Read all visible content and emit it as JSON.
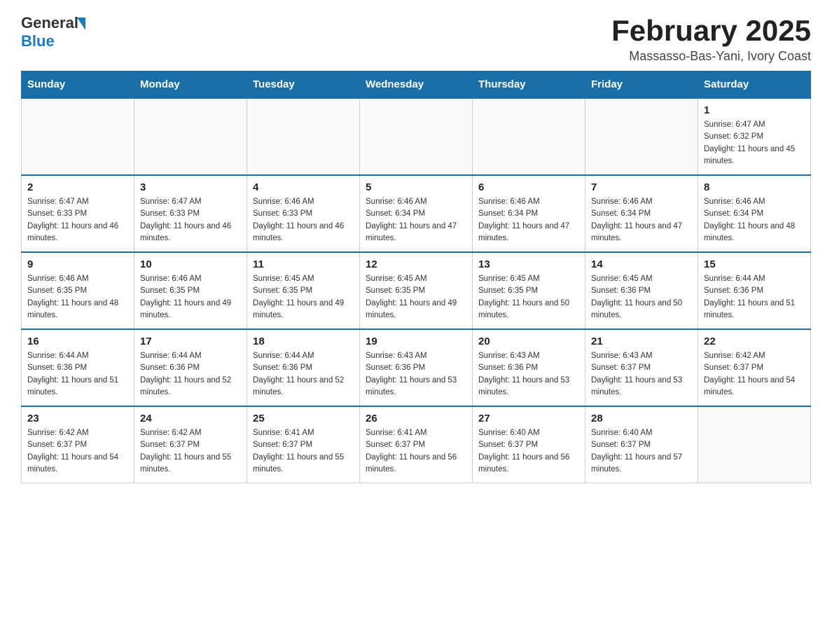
{
  "logo": {
    "general": "General",
    "blue": "Blue"
  },
  "title": "February 2025",
  "subtitle": "Massasso-Bas-Yani, Ivory Coast",
  "days_of_week": [
    "Sunday",
    "Monday",
    "Tuesday",
    "Wednesday",
    "Thursday",
    "Friday",
    "Saturday"
  ],
  "weeks": [
    [
      {
        "day": "",
        "info": ""
      },
      {
        "day": "",
        "info": ""
      },
      {
        "day": "",
        "info": ""
      },
      {
        "day": "",
        "info": ""
      },
      {
        "day": "",
        "info": ""
      },
      {
        "day": "",
        "info": ""
      },
      {
        "day": "1",
        "info": "Sunrise: 6:47 AM\nSunset: 6:32 PM\nDaylight: 11 hours and 45 minutes."
      }
    ],
    [
      {
        "day": "2",
        "info": "Sunrise: 6:47 AM\nSunset: 6:33 PM\nDaylight: 11 hours and 46 minutes."
      },
      {
        "day": "3",
        "info": "Sunrise: 6:47 AM\nSunset: 6:33 PM\nDaylight: 11 hours and 46 minutes."
      },
      {
        "day": "4",
        "info": "Sunrise: 6:46 AM\nSunset: 6:33 PM\nDaylight: 11 hours and 46 minutes."
      },
      {
        "day": "5",
        "info": "Sunrise: 6:46 AM\nSunset: 6:34 PM\nDaylight: 11 hours and 47 minutes."
      },
      {
        "day": "6",
        "info": "Sunrise: 6:46 AM\nSunset: 6:34 PM\nDaylight: 11 hours and 47 minutes."
      },
      {
        "day": "7",
        "info": "Sunrise: 6:46 AM\nSunset: 6:34 PM\nDaylight: 11 hours and 47 minutes."
      },
      {
        "day": "8",
        "info": "Sunrise: 6:46 AM\nSunset: 6:34 PM\nDaylight: 11 hours and 48 minutes."
      }
    ],
    [
      {
        "day": "9",
        "info": "Sunrise: 6:46 AM\nSunset: 6:35 PM\nDaylight: 11 hours and 48 minutes."
      },
      {
        "day": "10",
        "info": "Sunrise: 6:46 AM\nSunset: 6:35 PM\nDaylight: 11 hours and 49 minutes."
      },
      {
        "day": "11",
        "info": "Sunrise: 6:45 AM\nSunset: 6:35 PM\nDaylight: 11 hours and 49 minutes."
      },
      {
        "day": "12",
        "info": "Sunrise: 6:45 AM\nSunset: 6:35 PM\nDaylight: 11 hours and 49 minutes."
      },
      {
        "day": "13",
        "info": "Sunrise: 6:45 AM\nSunset: 6:35 PM\nDaylight: 11 hours and 50 minutes."
      },
      {
        "day": "14",
        "info": "Sunrise: 6:45 AM\nSunset: 6:36 PM\nDaylight: 11 hours and 50 minutes."
      },
      {
        "day": "15",
        "info": "Sunrise: 6:44 AM\nSunset: 6:36 PM\nDaylight: 11 hours and 51 minutes."
      }
    ],
    [
      {
        "day": "16",
        "info": "Sunrise: 6:44 AM\nSunset: 6:36 PM\nDaylight: 11 hours and 51 minutes."
      },
      {
        "day": "17",
        "info": "Sunrise: 6:44 AM\nSunset: 6:36 PM\nDaylight: 11 hours and 52 minutes."
      },
      {
        "day": "18",
        "info": "Sunrise: 6:44 AM\nSunset: 6:36 PM\nDaylight: 11 hours and 52 minutes."
      },
      {
        "day": "19",
        "info": "Sunrise: 6:43 AM\nSunset: 6:36 PM\nDaylight: 11 hours and 53 minutes."
      },
      {
        "day": "20",
        "info": "Sunrise: 6:43 AM\nSunset: 6:36 PM\nDaylight: 11 hours and 53 minutes."
      },
      {
        "day": "21",
        "info": "Sunrise: 6:43 AM\nSunset: 6:37 PM\nDaylight: 11 hours and 53 minutes."
      },
      {
        "day": "22",
        "info": "Sunrise: 6:42 AM\nSunset: 6:37 PM\nDaylight: 11 hours and 54 minutes."
      }
    ],
    [
      {
        "day": "23",
        "info": "Sunrise: 6:42 AM\nSunset: 6:37 PM\nDaylight: 11 hours and 54 minutes."
      },
      {
        "day": "24",
        "info": "Sunrise: 6:42 AM\nSunset: 6:37 PM\nDaylight: 11 hours and 55 minutes."
      },
      {
        "day": "25",
        "info": "Sunrise: 6:41 AM\nSunset: 6:37 PM\nDaylight: 11 hours and 55 minutes."
      },
      {
        "day": "26",
        "info": "Sunrise: 6:41 AM\nSunset: 6:37 PM\nDaylight: 11 hours and 56 minutes."
      },
      {
        "day": "27",
        "info": "Sunrise: 6:40 AM\nSunset: 6:37 PM\nDaylight: 11 hours and 56 minutes."
      },
      {
        "day": "28",
        "info": "Sunrise: 6:40 AM\nSunset: 6:37 PM\nDaylight: 11 hours and 57 minutes."
      },
      {
        "day": "",
        "info": ""
      }
    ]
  ]
}
